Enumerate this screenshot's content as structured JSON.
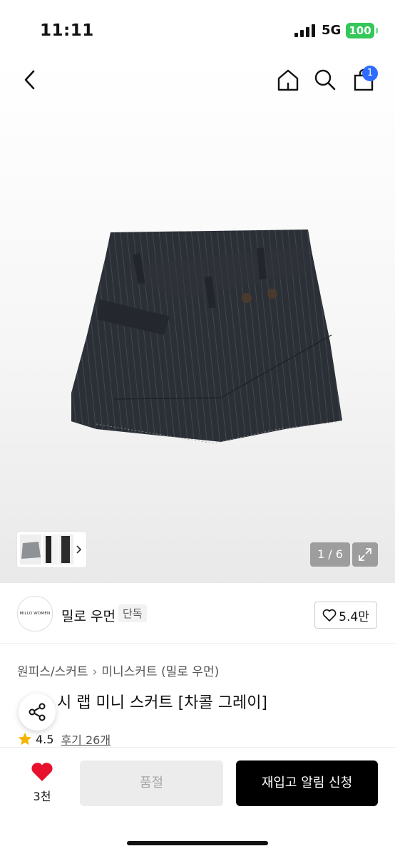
{
  "status_bar": {
    "time": "11:11",
    "network": "5G",
    "battery": "100"
  },
  "nav": {
    "cart_count": "1"
  },
  "gallery": {
    "counter": "1 / 6"
  },
  "brand": {
    "logo_text": "MILLO WOMEN",
    "name": "밀로 우먼",
    "tag": "단독",
    "likes": "5.4만"
  },
  "breadcrumb": {
    "category": "원피스/스커트",
    "subcategory": "미니스커트 (밀로 우먼)"
  },
  "product": {
    "title_visible": "시 랩 미니 스커트 [차콜 그레이]",
    "rating": "4.5",
    "reviews": "후기 26개"
  },
  "bottom": {
    "wish_count": "3천",
    "soldout_label": "품절",
    "restock_label": "재입고 알림 신청"
  },
  "colors": {
    "accent_blue": "#2f6bff",
    "battery_green": "#34c759",
    "heart_red": "#e8112d",
    "star_yellow": "#f5b400"
  }
}
